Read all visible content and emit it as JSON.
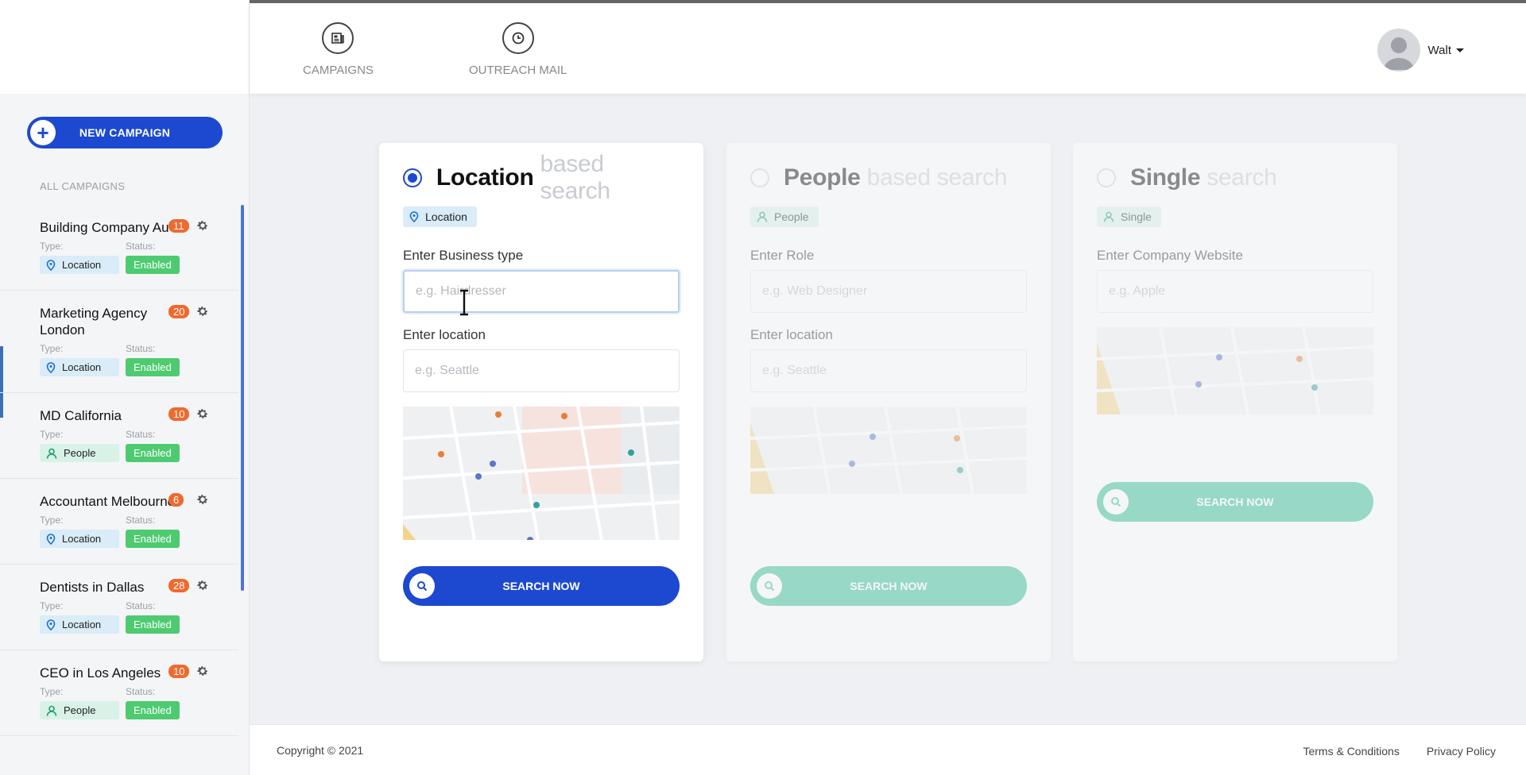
{
  "colors": {
    "primary": "#1c49d0",
    "accent_green": "#2ebc91",
    "badge_orange": "#ef6a2e",
    "enabled_green": "#4ecb71"
  },
  "sidebar": {
    "new_campaign_label": "NEW CAMPAIGN",
    "section_label": "ALL CAMPAIGNS",
    "type_label": "Type:",
    "status_label": "Status:",
    "campaigns": [
      {
        "title": "Building Company Au",
        "count": "11",
        "type": "Location",
        "type_icon": "location-pin-icon",
        "status": "Enabled"
      },
      {
        "title": "Marketing Agency London",
        "count": "20",
        "type": "Location",
        "type_icon": "location-pin-icon",
        "status": "Enabled"
      },
      {
        "title": "MD California",
        "count": "10",
        "type": "People",
        "type_icon": "person-icon",
        "status": "Enabled"
      },
      {
        "title": "Accountant Melbourne",
        "count": "6",
        "type": "Location",
        "type_icon": "location-pin-icon",
        "status": "Enabled"
      },
      {
        "title": "Dentists in Dallas",
        "count": "28",
        "type": "Location",
        "type_icon": "location-pin-icon",
        "status": "Enabled"
      },
      {
        "title": "CEO in Los Angeles",
        "count": "10",
        "type": "People",
        "type_icon": "person-icon",
        "status": "Enabled"
      }
    ]
  },
  "header": {
    "nav": [
      {
        "label": "CAMPAIGNS",
        "icon": "newspaper-icon"
      },
      {
        "label": "OUTREACH MAIL",
        "icon": "clock-icon"
      }
    ],
    "user_name": "Walt"
  },
  "cards": {
    "location": {
      "title": "Location",
      "subtitle": "based search",
      "tag": "Location",
      "selected": true,
      "field1_label": "Enter Business type",
      "field1_placeholder": "e.g. Hairdresser",
      "field2_label": "Enter location",
      "field2_placeholder": "e.g. Seattle",
      "button": "SEARCH NOW"
    },
    "people": {
      "title": "People",
      "subtitle": "based search",
      "tag": "People",
      "selected": false,
      "field1_label": "Enter Role",
      "field1_placeholder": "e.g. Web Designer",
      "field2_label": "Enter location",
      "field2_placeholder": "e.g. Seattle",
      "button": "SEARCH NOW"
    },
    "single": {
      "title": "Single",
      "subtitle": "search",
      "tag": "Single",
      "selected": false,
      "field1_label": "Enter Company Website",
      "field1_placeholder": "e.g. Apple",
      "button": "SEARCH NOW"
    }
  },
  "footer": {
    "copyright": "Copyright © 2021",
    "links": [
      "Terms & Conditions",
      "Privacy Policy"
    ]
  }
}
